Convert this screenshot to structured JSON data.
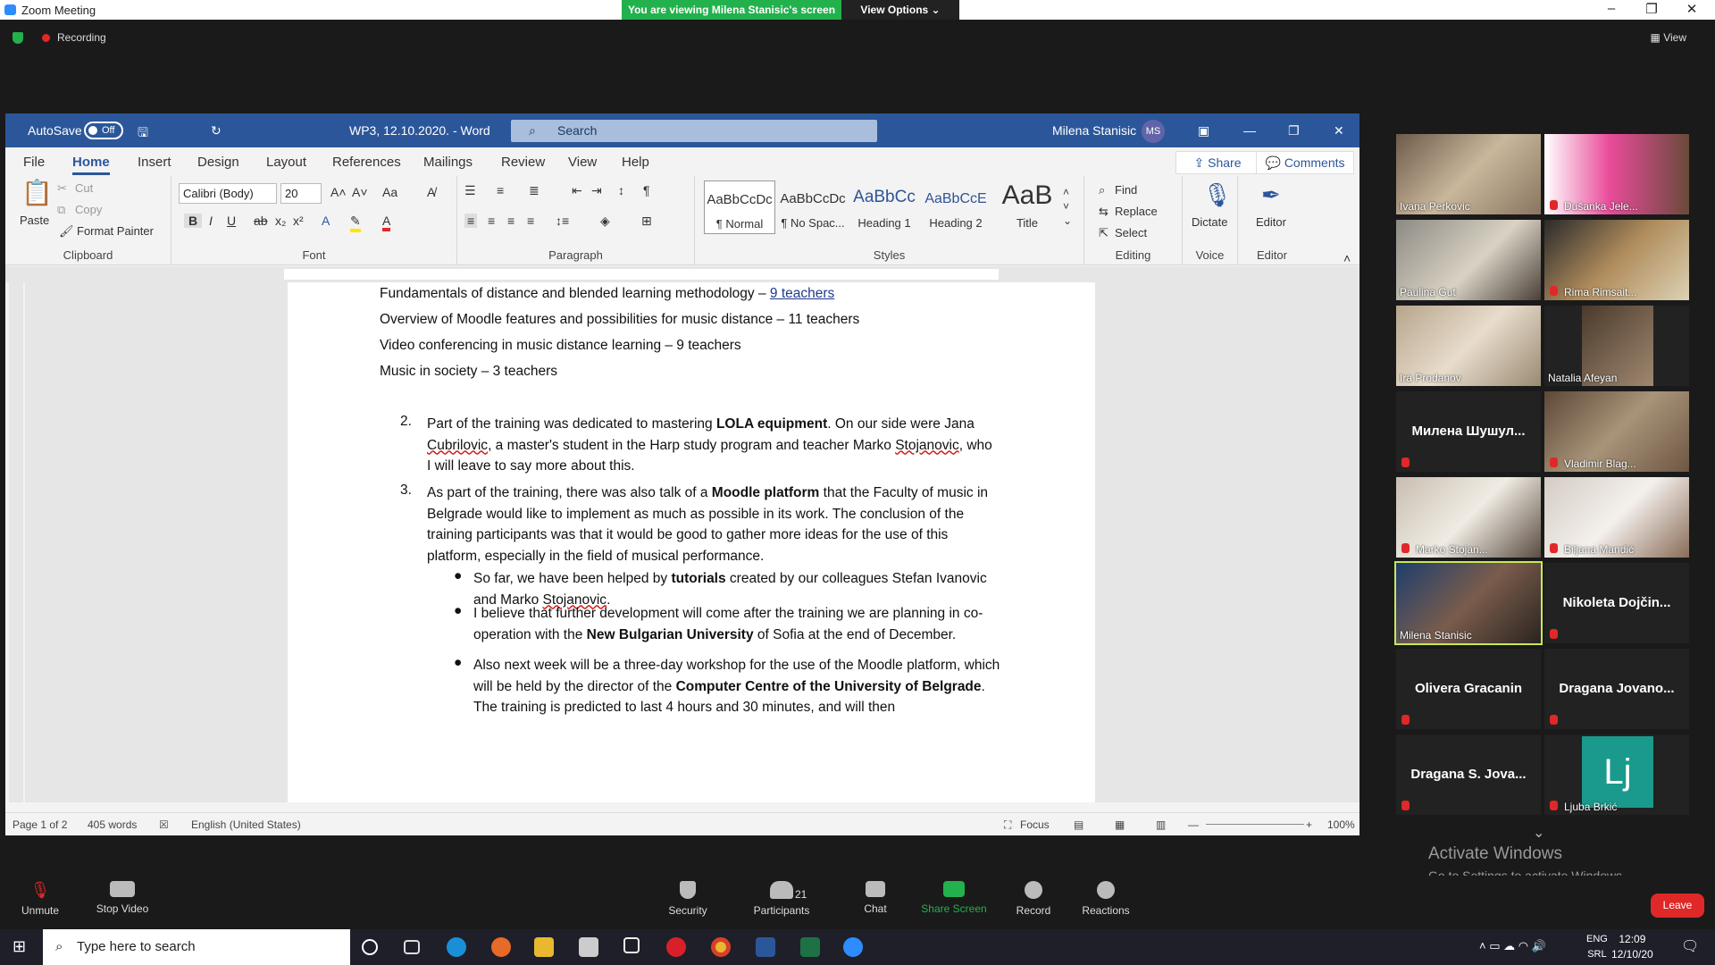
{
  "zoom": {
    "window_title": "Zoom Meeting",
    "viewing_banner": "You are viewing Milena Stanisic's screen",
    "view_options": "View Options",
    "recording": "Recording",
    "view_label": "View"
  },
  "word": {
    "autosave": "AutoSave",
    "autosave_state": "Off",
    "doc_title": "WP3, 12.10.2020.  -  Word",
    "search_placeholder": "Search",
    "user_name": "Milena Stanisic",
    "user_initials": "MS",
    "tabs": [
      "File",
      "Home",
      "Insert",
      "Design",
      "Layout",
      "References",
      "Mailings",
      "Review",
      "View",
      "Help"
    ],
    "share": "Share",
    "comments": "Comments",
    "ribbon": {
      "paste": "Paste",
      "cut": "Cut",
      "copy": "Copy",
      "format_painter": "Format Painter",
      "clipboard": "Clipboard",
      "font_name": "Calibri (Body)",
      "font_size": "20",
      "font": "Font",
      "paragraph": "Paragraph",
      "styles_label": "Styles",
      "styles": [
        {
          "sample": "AaBbCcDc",
          "name": "¶ Normal"
        },
        {
          "sample": "AaBbCcDc",
          "name": "¶ No Spac..."
        },
        {
          "sample": "AaBbCc",
          "name": "Heading 1"
        },
        {
          "sample": "AaBbCcE",
          "name": "Heading 2"
        },
        {
          "sample": "AaB",
          "name": "Title"
        }
      ],
      "find": "Find",
      "replace": "Replace",
      "select": "Select",
      "editing": "Editing",
      "dictate": "Dictate",
      "voice": "Voice",
      "editor": "Editor",
      "editor_group": "Editor"
    },
    "document": {
      "line1_a": "Fundamentals of distance and blended learning methodology – ",
      "line1_b": "9  teachers",
      "line2": "Overview of Moodle features and possibilities for music distance – 11 teachers",
      "line3": "Video conferencing in music distance learning – 9 teachers",
      "line4": "Music in society – 3 teachers",
      "item2_num": "2.",
      "item2_pre": "Part of the training was dedicated to mastering ",
      "item2_bold": "LOLA equipment",
      "item2_mid": ". On our side were Jana ",
      "item2_name1": "Cubrilovic",
      "item2_mid2": ", a master's student in the Harp study program and teacher Marko ",
      "item2_name2": "Stojanovic",
      "item2_post": ", who I will leave to say more about this.",
      "item3_num": "3.",
      "item3_pre": "As part of the training, there was also talk of a ",
      "item3_bold": "Moodle platform",
      "item3_post": " that the Faculty of music in Belgrade would like to implement as much as possible in its work.  The conclusion of the training participants was that it would be good to gather more ideas for the use of this platform, especially in the field of musical performance.",
      "b1_pre": "So far, we have been helped by ",
      "b1_bold": "tutorials",
      "b1_mid": " created by our colleagues Stefan Ivanovic and Marko ",
      "b1_name": "Stojanovic",
      "b1_post": ".",
      "b2_pre": "I believe that further development will come after the training we are planning in co-operation with the ",
      "b2_bold": "New Bulgarian University",
      "b2_post": " of Sofia at the end of December.",
      "b3_pre": "Also next week will be a three-day workshop for the use of the Moodle platform, which will be held by the director of the ",
      "b3_bold": "Computer Centre of the University of Belgrade",
      "b3_post": ". The training is predicted to last 4 hours and 30 minutes, and will then"
    },
    "status": {
      "page": "Page 1 of 2",
      "words": "405 words",
      "language": "English (United States)",
      "focus": "Focus",
      "zoom": "100%"
    }
  },
  "participants": [
    {
      "name": "Ivana Perkovic",
      "video": true
    },
    {
      "name": "Dušanka Jele...",
      "video": true
    },
    {
      "name": "Paulina Gut",
      "video": true
    },
    {
      "name": "Rima Rimsait...",
      "video": true
    },
    {
      "name": "Ira Prodanov",
      "video": true
    },
    {
      "name": "Natalia Afeyan",
      "video": true
    },
    {
      "name": "Милена  Шушул...",
      "video": false
    },
    {
      "name": "Vladimir Blag...",
      "video": true
    },
    {
      "name": "Marko Stojan...",
      "video": true
    },
    {
      "name": "Biljana Mandić",
      "video": true
    },
    {
      "name": "Milena Stanisic",
      "video": true
    },
    {
      "name": "Nikoleta  Dojčin...",
      "video": false
    },
    {
      "name": "Olivera Gracanin",
      "video": false
    },
    {
      "name": "Dragana  Jovano...",
      "video": false
    },
    {
      "name": "Dragana S. Jova...",
      "video": false
    },
    {
      "name": "Ljuba Brkić",
      "video": false,
      "initials": "Lj"
    }
  ],
  "watermark": {
    "line1": "Activate Windows",
    "line2": "Go to Settings to activate Windows."
  },
  "toolbar": {
    "unmute": "Unmute",
    "stop_video": "Stop Video",
    "security": "Security",
    "participants": "Participants",
    "participants_count": "21",
    "chat": "Chat",
    "share_screen": "Share Screen",
    "record": "Record",
    "reactions": "Reactions",
    "leave": "Leave"
  },
  "taskbar": {
    "search": "Type here to search",
    "lang1": "ENG",
    "lang2": "SRL",
    "time": "12:09",
    "date": "12/10/20"
  }
}
